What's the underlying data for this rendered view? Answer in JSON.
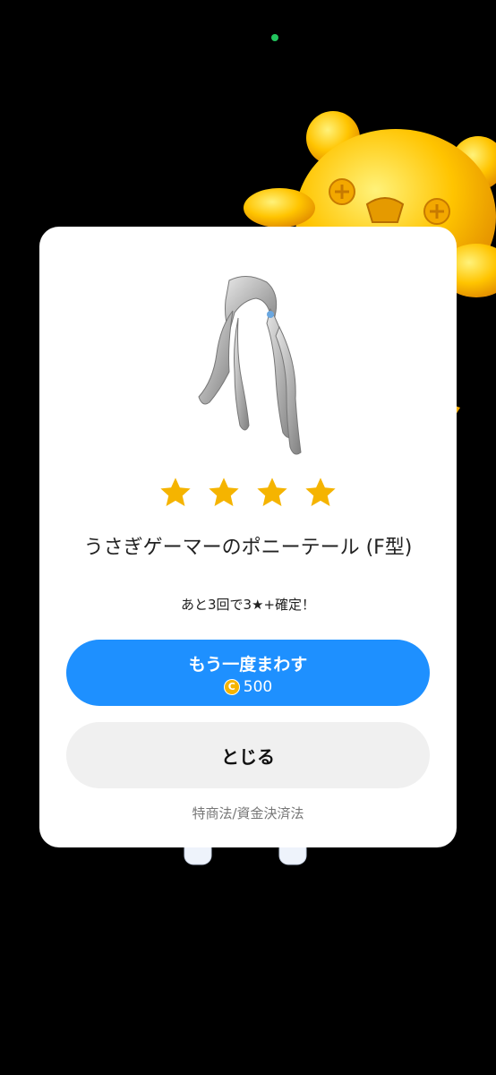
{
  "item": {
    "rarity_stars": 4,
    "name": "うさぎゲーマーのポニーテール (F型)"
  },
  "gacha": {
    "pity_text": "あと3回で3★+確定！",
    "retry_label": "もう一度まわす",
    "retry_cost": "500",
    "coin_symbol": "C",
    "close_label": "とじる",
    "legal_link": "特商法/資金決済法"
  },
  "colors": {
    "accent": "#1e90ff",
    "star": "#f5b400",
    "status_dot": "#22c55e"
  }
}
